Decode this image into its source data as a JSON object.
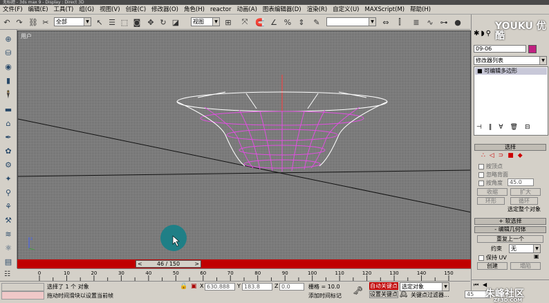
{
  "window": {
    "title": "无标题 - 3ds max 9 - Display : Direct 3D"
  },
  "menu": [
    "文件(F)",
    "编辑(E)",
    "工具(T)",
    "组(G)",
    "视图(V)",
    "创建(C)",
    "修改器(O)",
    "角色(H)",
    "reactor",
    "动画(A)",
    "图表编辑器(D)",
    "渲染(R)",
    "自定义(U)",
    "MAXScript(M)",
    "帮助(H)"
  ],
  "toolbar": {
    "selection_filter": "全部",
    "coord_system": "视图",
    "named_selection": "",
    "view_dropdown": "视图"
  },
  "viewport": {
    "label": "用户"
  },
  "timeline": {
    "frame_display": "46 / 150",
    "ticks": [
      "0",
      "10",
      "20",
      "30",
      "40",
      "50",
      "60",
      "70",
      "80",
      "90",
      "100",
      "110",
      "120",
      "130",
      "140",
      "150"
    ]
  },
  "status": {
    "selected": "选择了 1 个 对象",
    "prompt": "拖动时间滑块以设置当前帧",
    "x_label": "X",
    "x_value": "630.888",
    "y_label": "Y",
    "y_value": "183.8",
    "z_label": "Z",
    "z_value": "0.0",
    "grid": "栅格 = 10.0",
    "add_time_tag": "添加时间标记",
    "auto_key": "自动关键点",
    "set_key": "设置关键点",
    "selected_object": "选定对象",
    "key_filter": "关键点过滤器...",
    "frame": "45"
  },
  "panel": {
    "object_name": "09-06",
    "modifier_list": "修改器列表",
    "stack_item": "可编辑多边形",
    "selection_title": "选择",
    "by_vertex": "按顶点",
    "ignore_backfacing": "忽略背面",
    "by_angle": "按角度",
    "angle_value": "45.0",
    "shrink": "收缩",
    "grow": "扩大",
    "ring": "环形",
    "loop": "循环",
    "selected_info": "选定整个对象",
    "soft_selection": "软选择",
    "edit_geometry": "编辑几何体",
    "repeat_last": "重复上一个",
    "constraints_label": "约束",
    "constraints_value": "无",
    "preserve_uv": "保持 UV",
    "create": "创建",
    "collapse": "塌陷"
  },
  "watermarks": {
    "youku": "YOUKU 优酷",
    "site": "朱峰社区",
    "site_url": "ZF3D.COM"
  }
}
